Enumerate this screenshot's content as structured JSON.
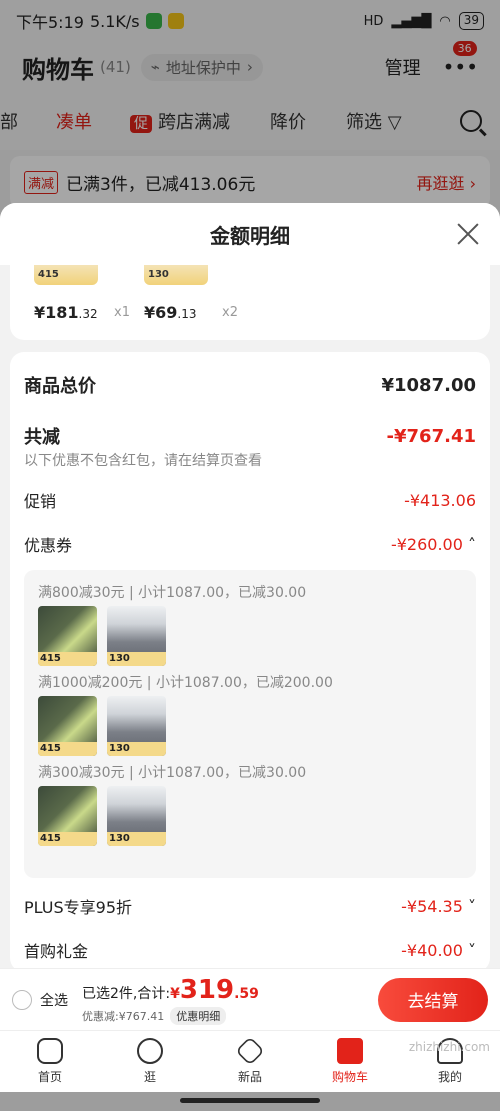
{
  "status": {
    "time": "下午5:19",
    "speed": "5.1K/s",
    "signal_text": "HD",
    "battery": "39"
  },
  "header": {
    "title": "购物车",
    "count": "(41)",
    "address": "地址保护中",
    "manage": "管理",
    "badge": "36"
  },
  "tabs": [
    {
      "label": "部"
    },
    {
      "label": "凑单"
    },
    {
      "label": "跨店满减",
      "badge": "促"
    },
    {
      "label": "降价"
    },
    {
      "label": "筛选"
    }
  ],
  "promo": {
    "tag": "满减",
    "text": "已满3件，已减413.06元",
    "link": "再逛逛"
  },
  "sheet": {
    "title": "金额明细",
    "items_top": [
      {
        "tag": "415",
        "price": "¥181",
        "cents": ".32",
        "qty": "x1"
      },
      {
        "tag": "130",
        "price": "¥69",
        "cents": ".13",
        "qty": "x2"
      }
    ],
    "total_label": "商品总价",
    "total_value": "¥1087.00",
    "reduce_label": "共减",
    "reduce_value": "-¥767.41",
    "reduce_note": "以下优惠不包含红包，请在结算页查看",
    "promo_label": "促销",
    "promo_value": "-¥413.06",
    "coupon_label": "优惠券",
    "coupon_value": "-¥260.00",
    "coupon_groups": [
      {
        "label": "满800减30元 | 小计1087.00，已减30.00",
        "tags": [
          "415",
          "130"
        ]
      },
      {
        "label": "满1000减200元 | 小计1087.00，已减200.00",
        "tags": [
          "415",
          "130"
        ]
      },
      {
        "label": "满300减30元 | 小计1087.00，已减30.00",
        "tags": [
          "415",
          "130"
        ]
      }
    ],
    "plus_label": "PLUS专享95折",
    "plus_value": "-¥54.35",
    "first_label": "首购礼金",
    "first_value": "-¥40.00"
  },
  "checkout": {
    "select_all": "全选",
    "selected": "已选2件,合计:",
    "currency": "¥",
    "amount": "319",
    "cents": ".59",
    "discount": "优惠减:¥767.41",
    "detail": "优惠明细",
    "button": "去结算"
  },
  "nav": [
    {
      "label": "首页"
    },
    {
      "label": "逛"
    },
    {
      "label": "新品"
    },
    {
      "label": "购物车"
    },
    {
      "label": "我的"
    }
  ],
  "watermark": "zhizhizhi.com",
  "colors": {
    "accent": "#e2231a"
  }
}
